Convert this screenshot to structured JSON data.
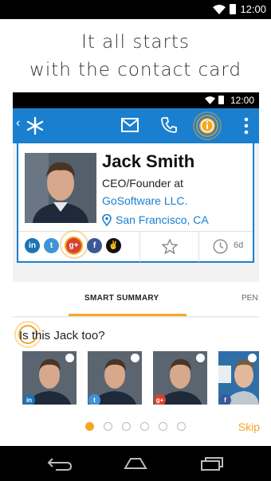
{
  "status": {
    "time": "12:00"
  },
  "headline": {
    "line1": "It all starts",
    "line2": "with the contact card"
  },
  "inner_status": {
    "time": "12:00"
  },
  "contact": {
    "name": "Jack Smith",
    "title": "CEO/Founder at",
    "company": "GoSoftware LLC.",
    "location": "San Francisco, CA",
    "last_contact": "6d"
  },
  "social": [
    {
      "name": "linkedin",
      "glyph": "in",
      "color": "#1b74b4"
    },
    {
      "name": "twitter",
      "glyph": "t",
      "color": "#3f94d8"
    },
    {
      "name": "google-plus",
      "glyph": "g+",
      "color": "#d9412e"
    },
    {
      "name": "facebook",
      "glyph": "f",
      "color": "#3b5998"
    },
    {
      "name": "angellist",
      "glyph": "✌",
      "color": "#111111"
    }
  ],
  "tabs": {
    "smart_summary": "SMART SUMMARY",
    "next": "PEN"
  },
  "summary": {
    "question": "Is this Jack too?",
    "thumbs": [
      {
        "badge": "in",
        "color": "#1b74b4"
      },
      {
        "badge": "t",
        "color": "#3f94d8"
      },
      {
        "badge": "g+",
        "color": "#d9412e"
      },
      {
        "badge": "f",
        "color": "#3b5998"
      }
    ]
  },
  "pager": {
    "count": 6,
    "active_index": 0
  },
  "skip_label": "Skip",
  "colors": {
    "accent": "#f5a623",
    "app_blue": "#1a7fcf"
  }
}
